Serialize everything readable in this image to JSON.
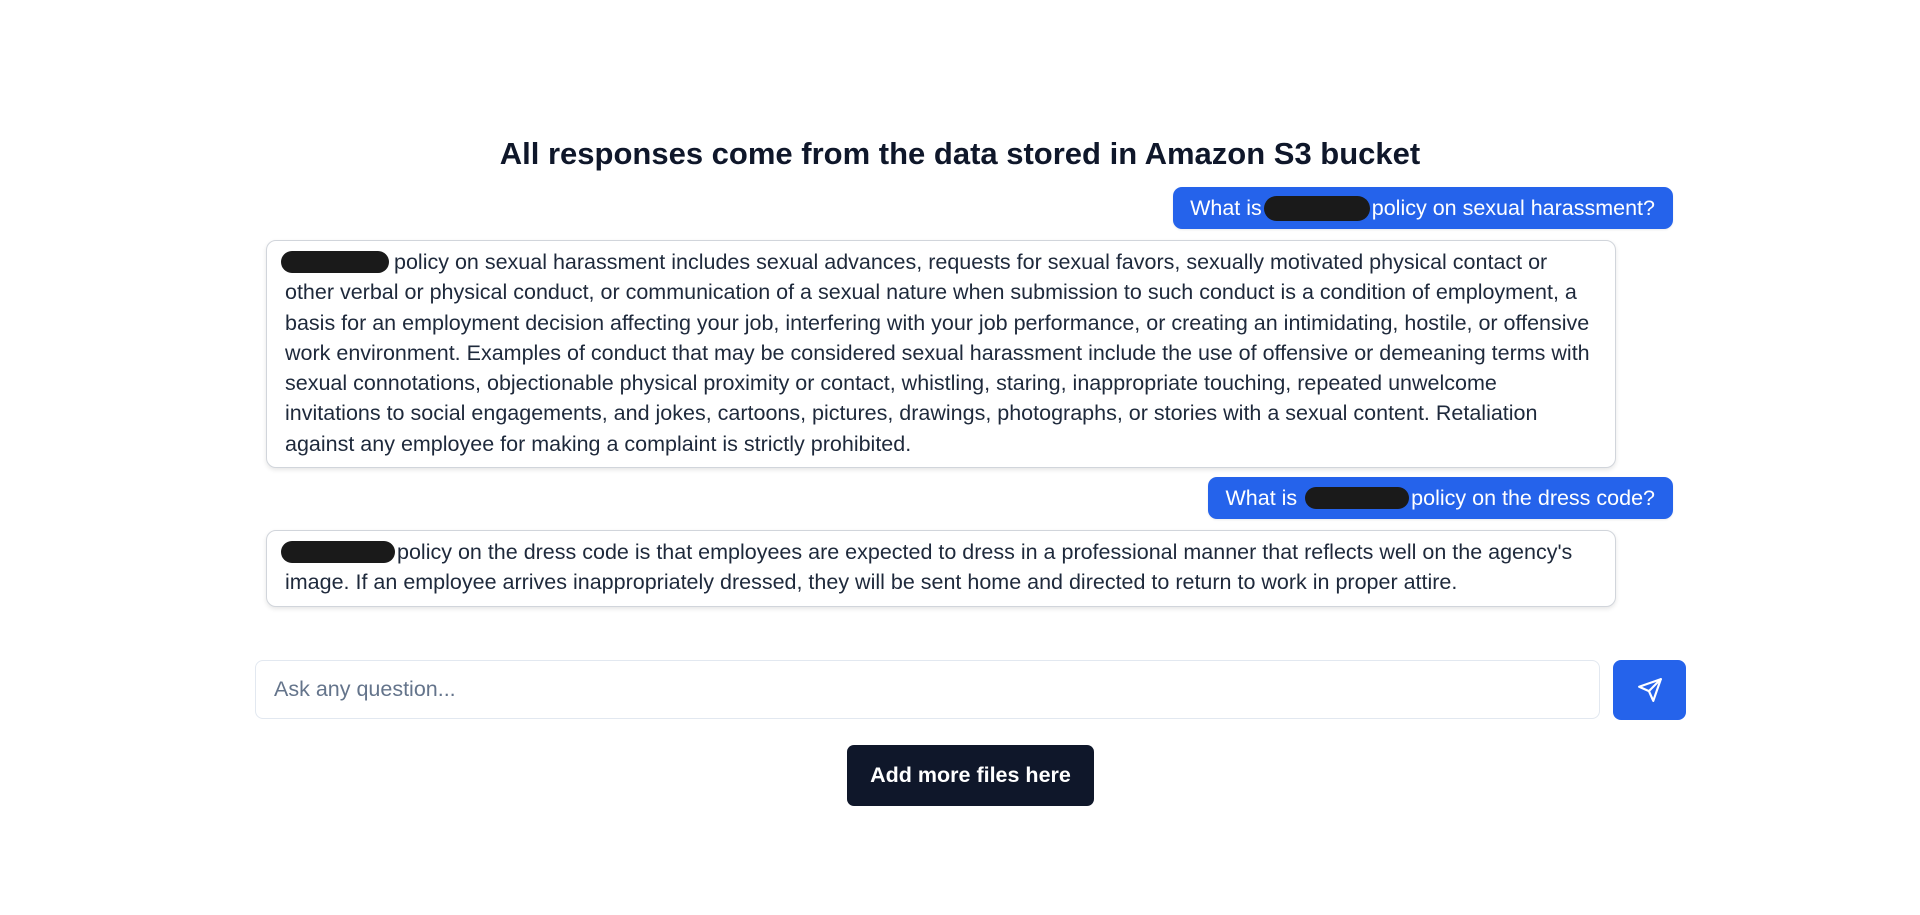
{
  "header": {
    "title": "All responses come from the data stored in Amazon S3 bucket"
  },
  "chat": {
    "messages": [
      {
        "role": "user",
        "before": "What is",
        "after": "policy on sexual harassment?"
      },
      {
        "role": "assistant",
        "text": "policy on sexual harassment includes sexual advances, requests for sexual favors, sexually motivated physical contact or other verbal or physical conduct, or communication of a sexual nature when submission to such conduct is a condition of employment, a basis for an employment decision affecting your job, interfering with your job performance, or creating an intimidating, hostile, or offensive work environment. Examples of conduct that may be considered sexual harassment include the use of offensive or demeaning terms with sexual connotations, objectionable physical proximity or contact, whistling, staring, inappropriate touching, repeated unwelcome invitations to social engagements, and jokes, cartoons, pictures, drawings, photographs, or stories with a sexual content. Retaliation against any employee for making a complaint is strictly prohibited."
      },
      {
        "role": "user",
        "before": "What is",
        "after": "policy on the dress code?"
      },
      {
        "role": "assistant",
        "text": "policy on the dress code is that employees are expected to dress in a professional manner that reflects well on the agency's image. If an employee arrives inappropriately dressed, they will be sent home and directed to return to work in proper attire."
      }
    ]
  },
  "composer": {
    "placeholder": "Ask any question...",
    "value": "",
    "send_icon": "send-icon"
  },
  "actions": {
    "add_files_label": "Add more files here"
  },
  "colors": {
    "accent": "#2563eb",
    "dark_button": "#0f172a",
    "redaction": "#1a1a1a"
  }
}
